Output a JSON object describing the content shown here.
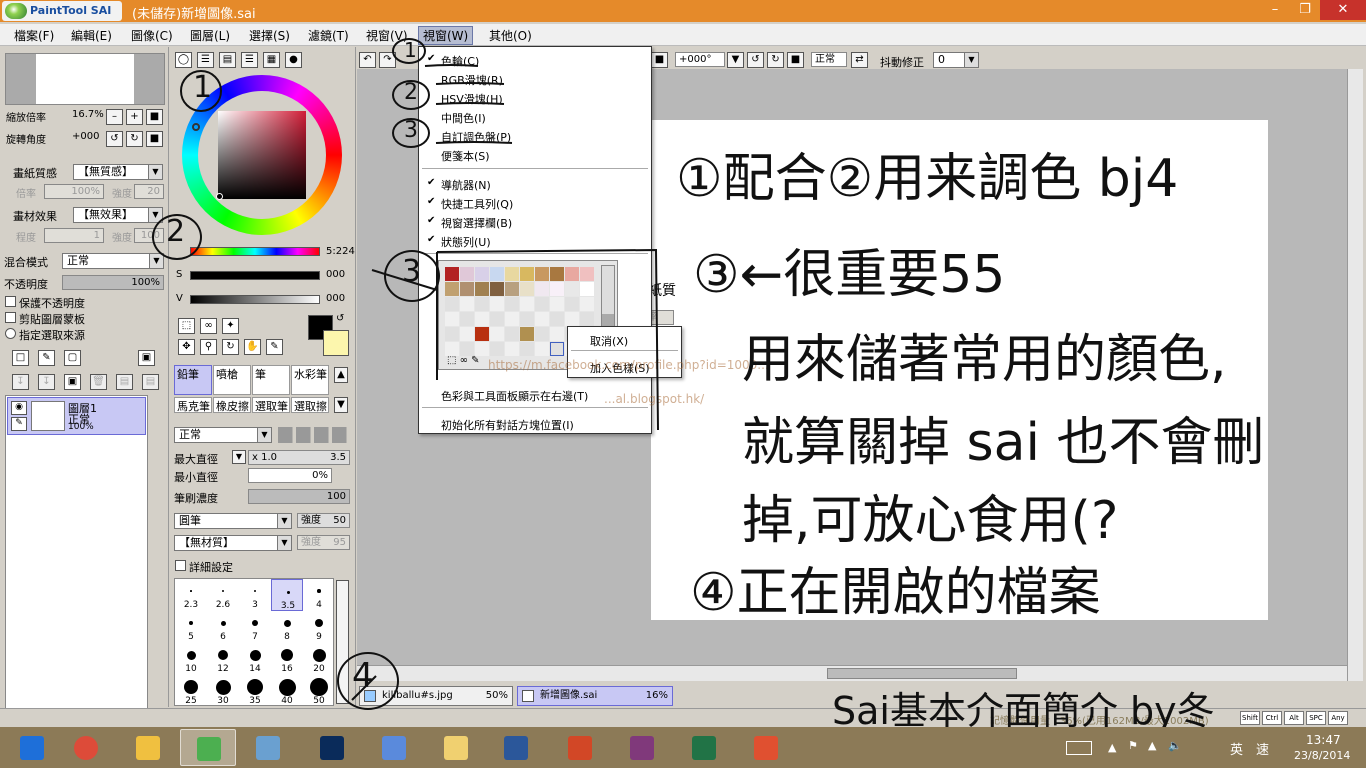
{
  "title_bar": {
    "logo_text": "PaintTool SAI",
    "document_title": "(未儲存)新增圖像.sai",
    "minimize_icon": "minimize-icon",
    "maximize_icon": "restore-icon",
    "close_icon": "close-icon"
  },
  "menu_bar": {
    "items": [
      "檔案(F)",
      "編輯(E)",
      "圖像(C)",
      "圖層(L)",
      "選擇(S)",
      "濾鏡(T)",
      "視窗(V)",
      "視窗(W)",
      "其他(O)"
    ]
  },
  "navigator": {
    "zoom_label": "縮放倍率",
    "zoom_value": "16.7%",
    "rotate_label": "旋轉角度",
    "rotate_value": "+000"
  },
  "layer_panel": {
    "paper_texture_label": "畫紙質感",
    "paper_texture_value": "【無質感】",
    "paper_rate_label": "倍率",
    "paper_rate_value": "100%",
    "paper_strength_label": "強度",
    "paper_strength_value": "20",
    "material_label": "畫材效果",
    "material_value": "【無效果】",
    "degree_label": "程度",
    "degree_value": "1",
    "material_strength_label": "強度",
    "material_strength_value": "100",
    "blend_mode_label": "混合模式",
    "blend_mode_value": "正常",
    "opacity_label": "不透明度",
    "opacity_value": "100%",
    "protect_opacity": "保護不透明度",
    "clip_group": "剪貼圖層蒙板",
    "selection_source": "指定選取來源",
    "layer_name": "圖層1",
    "layer_mode": "正常",
    "layer_opacity": "100%"
  },
  "color_panel": {
    "h_value": "5:224",
    "s_label": "S",
    "s_value": "000",
    "v_label": "V",
    "v_value": "000"
  },
  "tools": {
    "row1": [
      "鉛筆",
      "噴槍",
      "筆",
      "水彩筆"
    ],
    "row2": [
      "馬克筆",
      "橡皮擦",
      "選取筆",
      "選取擦"
    ],
    "mode": "正常",
    "max_size_label": "最大直徑",
    "max_size_mult": "x 1.0",
    "max_size_value": "3.5",
    "min_size_label": "最小直徑",
    "min_size_value": "0%",
    "density_label": "筆刷濃度",
    "density_value": "100",
    "shape_value": "圓筆",
    "shape_strength_label": "強度",
    "shape_strength_value": "50",
    "texture_value": "【無材質】",
    "texture_strength_label": "強度",
    "texture_strength_value": "95",
    "detail_label": "詳細設定",
    "size_labels": [
      "2.3",
      "2.6",
      "3",
      "3.5",
      "4",
      "5",
      "6",
      "7",
      "8",
      "9",
      "10",
      "12",
      "14",
      "16",
      "20",
      "25",
      "30",
      "35",
      "40",
      "50"
    ]
  },
  "toolbar2": {
    "angle_value": "+000°",
    "mode_value": "正常",
    "stabilizer_label": "抖動修正",
    "stabilizer_value": "0"
  },
  "window_menu": {
    "items": [
      {
        "label": "色輪(C)",
        "checked": true
      },
      {
        "label": "RGB滑塊(R)",
        "checked": false
      },
      {
        "label": "HSV滑塊(H)",
        "checked": false
      },
      {
        "label": "中間色(I)",
        "checked": false
      },
      {
        "label": "自訂調色盤(P)",
        "checked": false
      },
      {
        "label": "便箋本(S)",
        "checked": false
      },
      {
        "label": "導航器(N)",
        "checked": true
      },
      {
        "label": "快捷工具列(Q)",
        "checked": true
      },
      {
        "label": "視窗選擇欄(B)",
        "checked": true
      },
      {
        "label": "狀態列(U)",
        "checked": true
      },
      {
        "label": "色彩與工具面板顯示在右邊(T)",
        "checked": false
      },
      {
        "label": "初始化所有對話方塊位置(I)",
        "checked": false
      }
    ]
  },
  "palette_context_menu": {
    "items": [
      "取消(X)",
      "加入色樣(S)"
    ]
  },
  "background_fragment": {
    "text": "畫紙質",
    "field": "倍率"
  },
  "watermark": {
    "line1": "https://m.facebook.com/profile.php?id=1000...",
    "line2": "...al.blogspot.hk/"
  },
  "documents": [
    {
      "name": "killballu#s.jpg",
      "zoom": "50%"
    },
    {
      "name": "新增圖像.sai",
      "zoom": "16%"
    }
  ],
  "annotations": {
    "left_1": "1",
    "left_2": "2",
    "left_3": "3",
    "left_4": "4",
    "menu_1": "1",
    "menu_2": "2",
    "menu_3": "3",
    "canvas_lines": [
      "①配合②用来調色 bj4",
      "③←很重要55",
      "用來儲著常用的顏色,",
      "就算關掉 sai 也不會刪",
      "掉,可放心食用(?",
      "④正在開啟的檔案"
    ],
    "footer": "Sai基本介面簡介 by冬"
  },
  "status_bar": {
    "memory_text": "記憶體使用量 : 36%(已用162MB/最大1002MB)",
    "key_indicators": [
      "Shift",
      "Ctrl",
      "Alt",
      "SPC",
      "Any"
    ]
  },
  "taskbar": {
    "apps": [
      "start",
      "chrome",
      "paint",
      "sai",
      "network",
      "photoshop",
      "pen",
      "explorer",
      "word",
      "powerpoint",
      "onenote",
      "excel",
      "apps"
    ],
    "ime_label": "英",
    "ime_label2": "速",
    "time": "13:47",
    "date": "23/8/2014"
  },
  "colors": {
    "titlebar": "#e58a2a",
    "close_button": "#c7322b",
    "menu_active": "#b6bdd2",
    "layer_selected": "#c8c8f4",
    "taskbar": "#8c7a57"
  }
}
